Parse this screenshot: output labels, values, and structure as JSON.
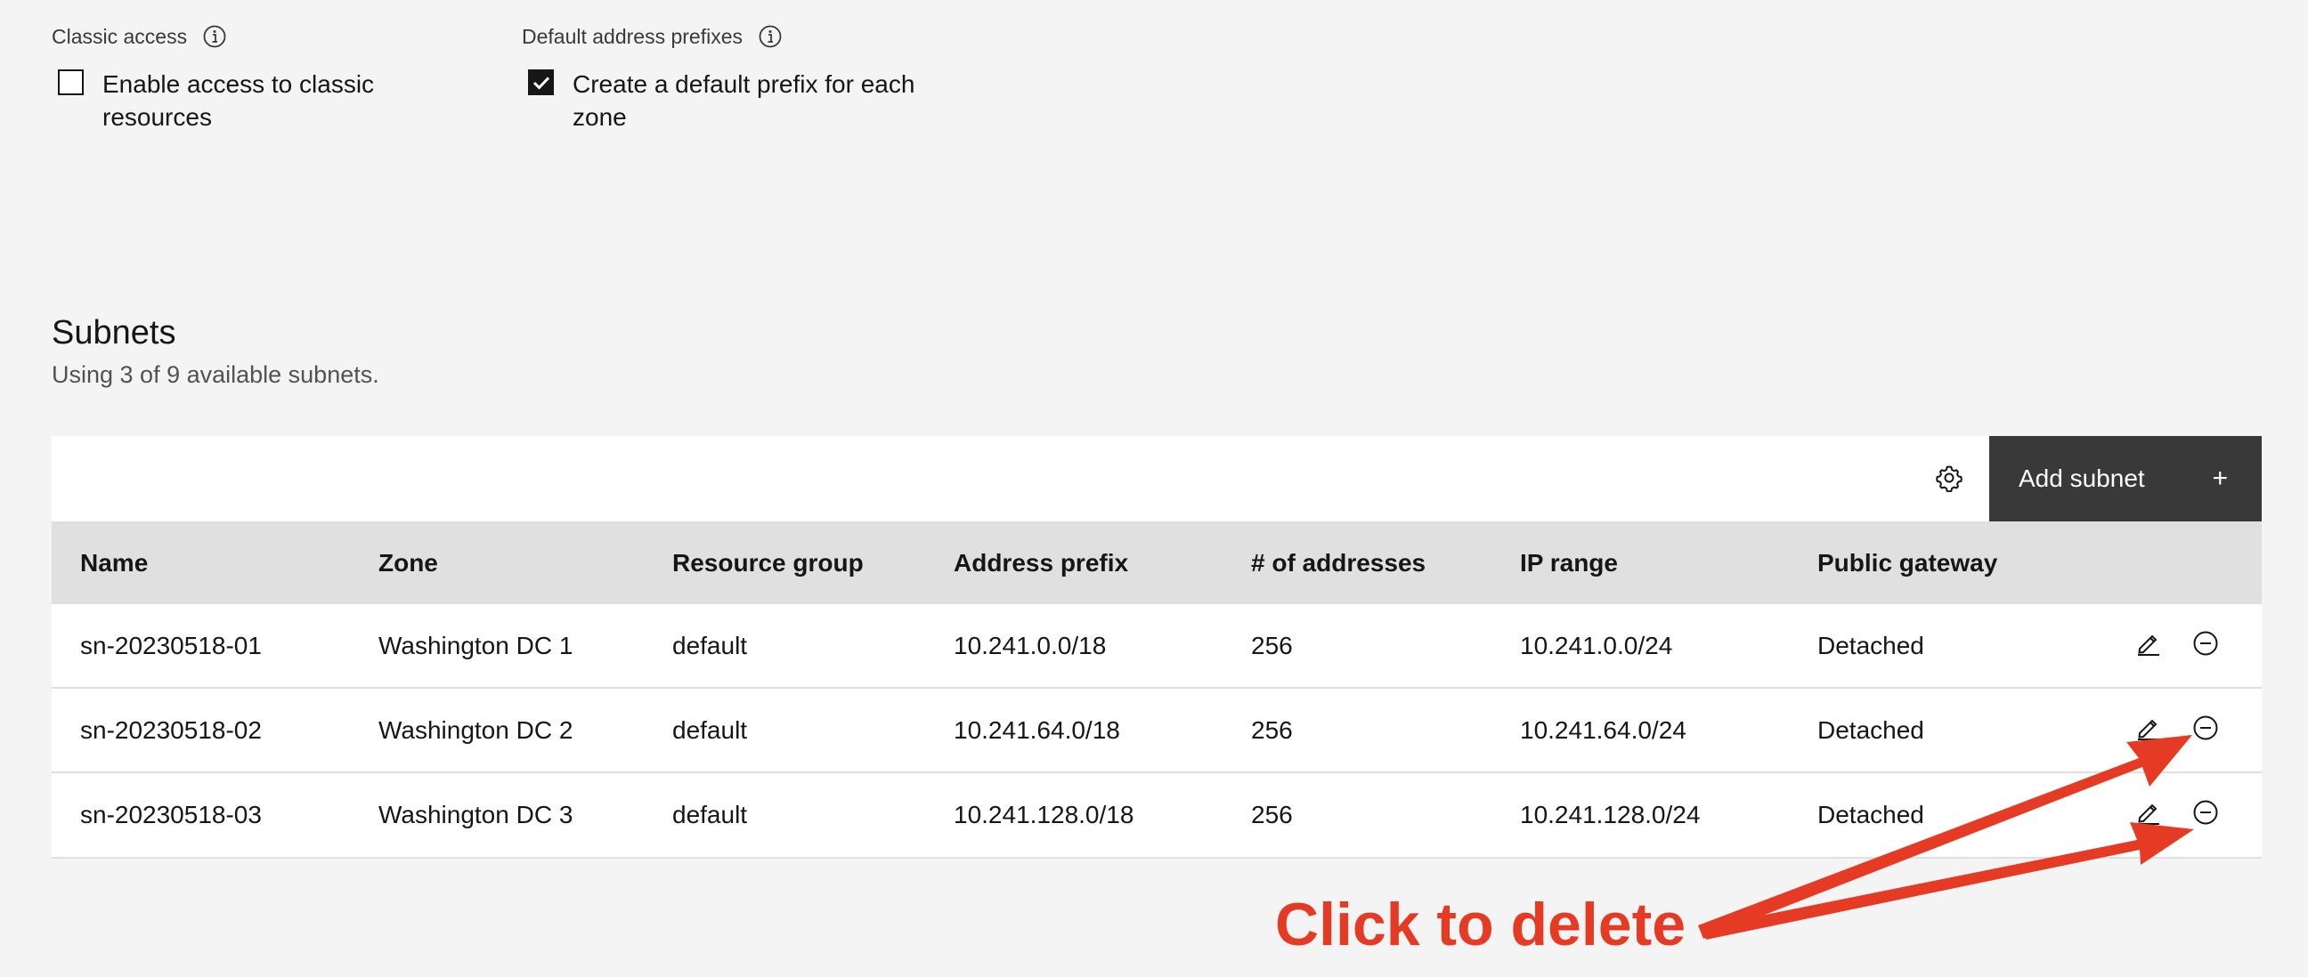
{
  "classic_access": {
    "label": "Classic access",
    "checkbox_text_line1": "Enable access to classic",
    "checkbox_text_line2": "resources",
    "checked": false
  },
  "default_prefixes": {
    "label": "Default address prefixes",
    "checkbox_text_line1": "Create a default prefix for each",
    "checkbox_text_line2": "zone",
    "checked": true
  },
  "subnets": {
    "title": "Subnets",
    "subtitle": "Using 3 of 9 available subnets.",
    "add_button_label": "Add subnet",
    "add_button_icon": "+",
    "columns": [
      "Name",
      "Zone",
      "Resource group",
      "Address prefix",
      "# of addresses",
      "IP range",
      "Public gateway"
    ],
    "rows": [
      [
        "sn-20230518-01",
        "Washington DC 1",
        "default",
        "10.241.0.0/18",
        "256",
        "10.241.0.0/24",
        "Detached"
      ],
      [
        "sn-20230518-02",
        "Washington DC 2",
        "default",
        "10.241.64.0/18",
        "256",
        "10.241.64.0/24",
        "Detached"
      ],
      [
        "sn-20230518-03",
        "Washington DC 3",
        "default",
        "10.241.128.0/18",
        "256",
        "10.241.128.0/24",
        "Detached"
      ]
    ]
  },
  "annotation": {
    "text": "Click to delete",
    "color": "#e53a24"
  },
  "icons": {
    "info": "info-icon",
    "settings": "gear-icon",
    "edit": "edit-pencil-icon",
    "delete": "remove-circle-icon"
  },
  "colors": {
    "background": "#f4f4f4",
    "header_row": "#e0e0e0",
    "button": "#393939",
    "annotation": "#e53a24"
  }
}
